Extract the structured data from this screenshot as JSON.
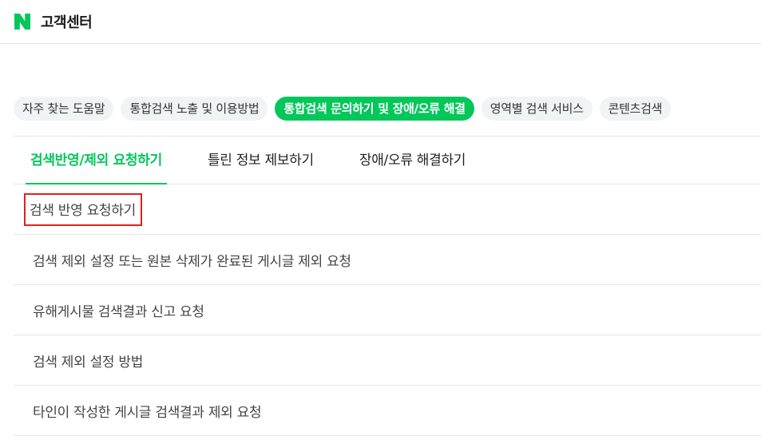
{
  "header": {
    "title": "고객센터",
    "brand_color": "#03c75a"
  },
  "chips": [
    {
      "label": "자주 찾는 도움말",
      "active": false
    },
    {
      "label": "통합검색 노출 및 이용방법",
      "active": false
    },
    {
      "label": "통합검색 문의하기 및 장애/오류 해결",
      "active": true
    },
    {
      "label": "영역별 검색 서비스",
      "active": false
    },
    {
      "label": "콘텐츠검색",
      "active": false
    }
  ],
  "tabs": [
    {
      "label": "검색반영/제외 요청하기",
      "active": true
    },
    {
      "label": "틀린 정보 제보하기",
      "active": false
    },
    {
      "label": "장애/오류 해결하기",
      "active": false
    }
  ],
  "list": [
    {
      "label": "검색 반영 요청하기",
      "highlighted": true
    },
    {
      "label": "검색 제외 설정 또는 원본 삭제가 완료된 게시글 제외 요청",
      "highlighted": false
    },
    {
      "label": "유해게시물 검색결과 신고 요청",
      "highlighted": false
    },
    {
      "label": "검색 제외 설정 방법",
      "highlighted": false
    },
    {
      "label": "타인이 작성한 게시글 검색결과 제외 요청",
      "highlighted": false
    }
  ]
}
